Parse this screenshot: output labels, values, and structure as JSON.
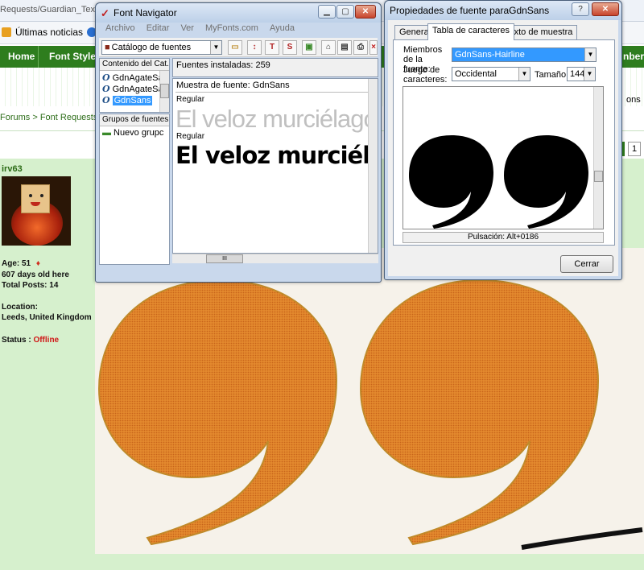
{
  "browser": {
    "url": "Requests/Guardian_Text_Ea",
    "bookmarks_label": "Últimas noticias",
    "nav": [
      "Home",
      "Font Styles"
    ],
    "nav_right_fragment": "nbers",
    "nav_right_fragment2": "ons",
    "breadcrumb": "Forums > Font Requests > ",
    "page_number": "1"
  },
  "profile": {
    "username": "irv63",
    "age": "Age: 51",
    "days_old": "607 days old here",
    "total_posts": "Total Posts: 14",
    "location_label": "Location:",
    "location_value": "Leeds, United Kingdom",
    "status_label": "Status : ",
    "status_value": "Offline"
  },
  "font_navigator": {
    "title": "Font Navigator",
    "menu": [
      "Archivo",
      "Editar",
      "Ver",
      "MyFonts.com",
      "Ayuda"
    ],
    "catalog_combo": "Catálogo de fuentes",
    "toolbar_icons": [
      "folder-icon",
      "sort-icon",
      "text-t-icon",
      "strike-s-icon",
      "add-icon",
      "properties-icon",
      "preview-icon",
      "print-icon",
      "close-icon"
    ],
    "catalog_panel_header": "Contenido del Cat...",
    "catalog_items": [
      "GdnAgateSa",
      "GdnAgateSa",
      "GdnSans"
    ],
    "groups_header": "Grupos de fuentes",
    "groups_items": [
      "Nuevo grupc"
    ],
    "installed_fonts": "Fuentes instaladas: 259",
    "sample_label": "Muestra de fuente:   GdnSans",
    "sample_style_1": "Regular",
    "sample_text_1": "El veloz murciélago",
    "sample_style_2": "Regular",
    "sample_text_2": "El veloz murciél",
    "hscroll_grip": "III"
  },
  "properties_dialog": {
    "title": "Propiedades de fuente paraGdnSans",
    "help_btn": "?",
    "close_btn": "✕",
    "tabs": [
      "General",
      "Tabla de caracteres",
      "Texto de muestra"
    ],
    "active_tab": "Tabla de caracteres",
    "members_label": "Miembros de la fuente:",
    "members_value": "GdnSans-Hairline",
    "charset_label": "Juego de caracteres:",
    "charset_value": "Occidental",
    "size_label": "Tamaño:",
    "size_value": "144",
    "glyph_preview": "”",
    "keystroke": "Pulsación: Alt+0186",
    "close_button": "Cerrar"
  },
  "colors": {
    "nav_green": "#2e7d1e",
    "side_green": "#d6f0cd",
    "offline_red": "#d01818",
    "selection_blue": "#3399ff",
    "quote_orange": "#e07a1e"
  }
}
